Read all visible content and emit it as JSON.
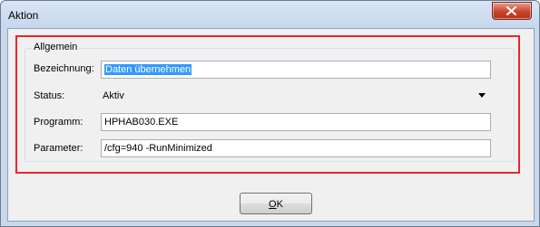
{
  "window": {
    "title": "Aktion"
  },
  "group": {
    "title": "Allgemein"
  },
  "fields": {
    "bezeichnung": {
      "label": "Bezeichnung:",
      "value": "Daten übernehmen"
    },
    "status": {
      "label": "Status:",
      "value": "Aktiv"
    },
    "programm": {
      "label": "Programm:",
      "value": "HPHAB030.EXE"
    },
    "parameter": {
      "label": "Parameter:",
      "value": "/cfg=940 -RunMinimized"
    }
  },
  "buttons": {
    "ok": "OK"
  },
  "colors": {
    "highlight_border": "#e8262d",
    "selection": "#3399ff",
    "close_button": "#c8432f"
  },
  "icons": {
    "close": "close-icon",
    "dropdown": "chevron-down-icon"
  }
}
